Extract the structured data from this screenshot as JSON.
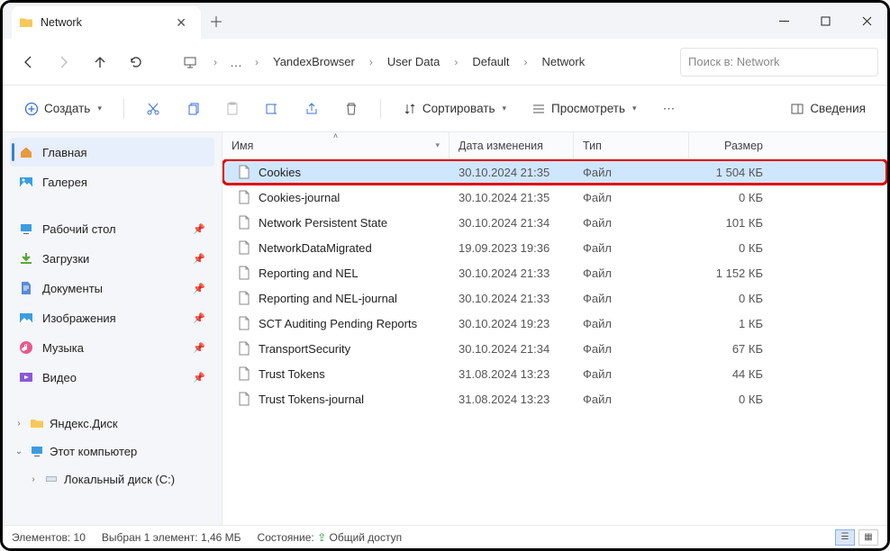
{
  "window": {
    "title": "Network"
  },
  "breadcrumbs": [
    "YandexBrowser",
    "User Data",
    "Default",
    "Network"
  ],
  "search": {
    "placeholder": "Поиск в: Network"
  },
  "toolbar": {
    "create": "Создать",
    "sort": "Сортировать",
    "view": "Просмотреть",
    "details": "Сведения"
  },
  "sidebar": {
    "home": "Главная",
    "gallery": "Галерея",
    "desktop": "Рабочий стол",
    "downloads": "Загрузки",
    "documents": "Документы",
    "pictures": "Изображения",
    "music": "Музыка",
    "videos": "Видео",
    "yadisk": "Яндекс.Диск",
    "thispc": "Этот компьютер",
    "localdisk": "Локальный диск (C:)"
  },
  "columns": {
    "name": "Имя",
    "date": "Дата изменения",
    "type": "Тип",
    "size": "Размер"
  },
  "files": [
    {
      "name": "Cookies",
      "date": "30.10.2024 21:35",
      "type": "Файл",
      "size": "1 504 КБ",
      "selected": true,
      "highlight": true
    },
    {
      "name": "Cookies-journal",
      "date": "30.10.2024 21:35",
      "type": "Файл",
      "size": "0 КБ"
    },
    {
      "name": "Network Persistent State",
      "date": "30.10.2024 21:34",
      "type": "Файл",
      "size": "101 КБ"
    },
    {
      "name": "NetworkDataMigrated",
      "date": "19.09.2023 19:36",
      "type": "Файл",
      "size": "0 КБ"
    },
    {
      "name": "Reporting and NEL",
      "date": "30.10.2024 21:33",
      "type": "Файл",
      "size": "1 152 КБ"
    },
    {
      "name": "Reporting and NEL-journal",
      "date": "30.10.2024 21:33",
      "type": "Файл",
      "size": "0 КБ"
    },
    {
      "name": "SCT Auditing Pending Reports",
      "date": "30.10.2024 19:23",
      "type": "Файл",
      "size": "1 КБ"
    },
    {
      "name": "TransportSecurity",
      "date": "30.10.2024 21:34",
      "type": "Файл",
      "size": "67 КБ"
    },
    {
      "name": "Trust Tokens",
      "date": "31.08.2024 13:23",
      "type": "Файл",
      "size": "44 КБ"
    },
    {
      "name": "Trust Tokens-journal",
      "date": "31.08.2024 13:23",
      "type": "Файл",
      "size": "0 КБ"
    }
  ],
  "status": {
    "count": "Элементов: 10",
    "selection": "Выбран 1 элемент: 1,46 МБ",
    "state_label": "Состояние:",
    "shared": "Общий доступ"
  }
}
